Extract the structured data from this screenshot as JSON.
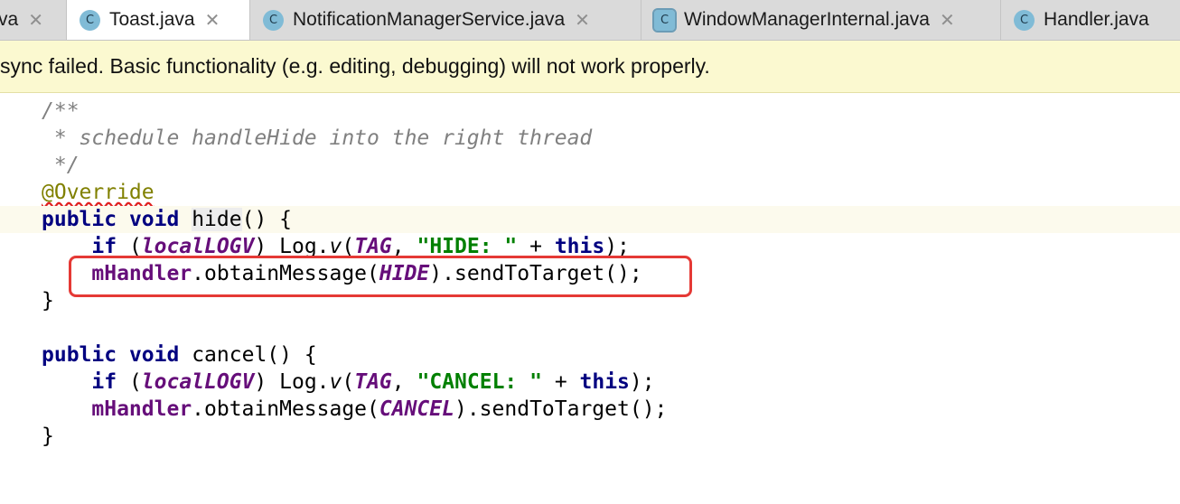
{
  "tabs": [
    {
      "label": "va",
      "icon": "",
      "close": "✕",
      "active": false
    },
    {
      "label": "Toast.java",
      "icon": "C",
      "close": "✕",
      "active": true
    },
    {
      "label": "NotificationManagerService.java",
      "icon": "C",
      "close": "✕",
      "active": false
    },
    {
      "label": "WindowManagerInternal.java",
      "icon": "C",
      "close": "✕",
      "active": false
    },
    {
      "label": "Handler.java",
      "icon": "C",
      "close": "",
      "active": false
    }
  ],
  "banner": {
    "text": "sync failed. Basic functionality (e.g. editing, debugging) will not work properly."
  },
  "code": {
    "comment_open": "/**",
    "comment_body": " * schedule handleHide into the right thread",
    "comment_close": " */",
    "annotation": "@Override",
    "hide_kw1": "public",
    "hide_kw2": "void",
    "hide_name": "hide",
    "hide_tail": "() {",
    "if_kw": "if",
    "localLOGV": "localLOGV",
    "log": "Log.",
    "v": "v",
    "tag": "TAG",
    "hide_str": "\"HIDE: \"",
    "plus": " + ",
    "this_kw": "this",
    "mHandler": "mHandler",
    "obtain": ".obtainMessage(",
    "HIDE": "HIDE",
    "send": ").sendToTarget();",
    "close_brace": "}",
    "cancel_name": "cancel",
    "cancel_str": "\"CANCEL: \"",
    "CANCEL": "CANCEL"
  }
}
